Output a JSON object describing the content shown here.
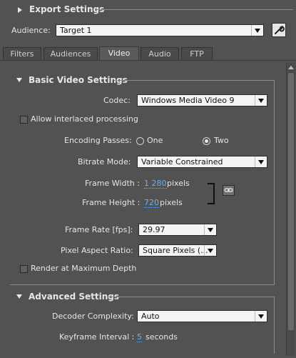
{
  "export": {
    "title": "Export Settings"
  },
  "audience": {
    "label": "Audience:",
    "value": "Target 1"
  },
  "tabs": [
    {
      "label": "Filters"
    },
    {
      "label": "Audiences"
    },
    {
      "label": "Video"
    },
    {
      "label": "Audio"
    },
    {
      "label": "FTP"
    }
  ],
  "basic": {
    "title": "Basic Video Settings",
    "codec_label": "Codec:",
    "codec_value": "Windows Media Video 9",
    "interlaced_label": "Allow interlaced processing",
    "passes_label": "Encoding Passes:",
    "pass_one": "One",
    "pass_two": "Two",
    "bitrate_label": "Bitrate Mode:",
    "bitrate_value": "Variable Constrained",
    "width_label": "Frame Width :",
    "width_value": "1 280",
    "width_unit": "pixels",
    "height_label": "Frame Height :",
    "height_value": "720",
    "height_unit": "pixels",
    "framerate_label": "Frame Rate [fps]:",
    "framerate_value": "29.97",
    "aspect_label": "Pixel Aspect Ratio:",
    "aspect_value": "Square Pixels (...",
    "render_label": "Render at Maximum Depth"
  },
  "advanced": {
    "title": "Advanced Settings",
    "decoder_label": "Decoder Complexity:",
    "decoder_value": "Auto",
    "keyframe_label": "Keyframe Interval :",
    "keyframe_value": "5",
    "keyframe_unit": "seconds"
  }
}
